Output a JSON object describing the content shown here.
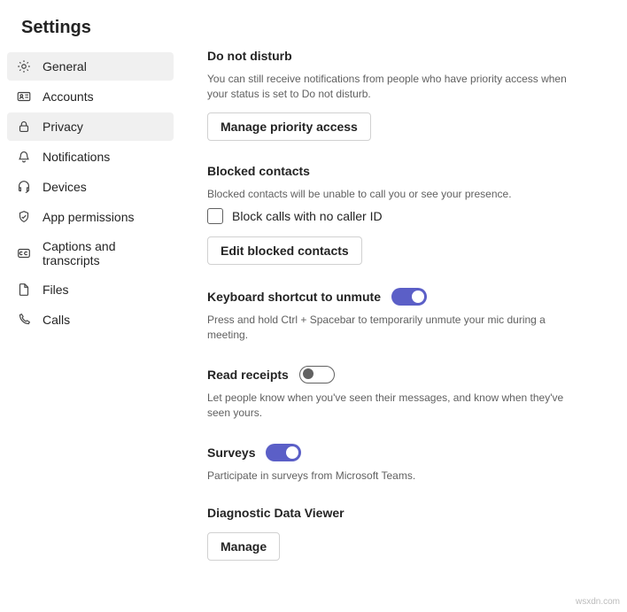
{
  "page_title": "Settings",
  "sidebar": {
    "items": [
      {
        "label": "General"
      },
      {
        "label": "Accounts"
      },
      {
        "label": "Privacy"
      },
      {
        "label": "Notifications"
      },
      {
        "label": "Devices"
      },
      {
        "label": "App permissions"
      },
      {
        "label": "Captions and transcripts"
      },
      {
        "label": "Files"
      },
      {
        "label": "Calls"
      }
    ]
  },
  "dnd": {
    "title": "Do not disturb",
    "desc": "You can still receive notifications from people who have priority access when your status is set to Do not disturb.",
    "button": "Manage priority access"
  },
  "blocked": {
    "title": "Blocked contacts",
    "desc": "Blocked contacts will be unable to call you or see your presence.",
    "checkbox_label": "Block calls with no caller ID",
    "checkbox_checked": false,
    "button": "Edit blocked contacts"
  },
  "keyboard": {
    "title": "Keyboard shortcut to unmute",
    "toggle": true,
    "desc": "Press and hold Ctrl + Spacebar to temporarily unmute your mic during a meeting."
  },
  "receipts": {
    "title": "Read receipts",
    "toggle": false,
    "desc": "Let people know when you've seen their messages, and know when they've seen yours."
  },
  "surveys": {
    "title": "Surveys",
    "toggle": true,
    "desc": "Participate in surveys from Microsoft Teams."
  },
  "diag": {
    "title": "Diagnostic Data Viewer",
    "button": "Manage"
  },
  "watermark": "wsxdn.com"
}
